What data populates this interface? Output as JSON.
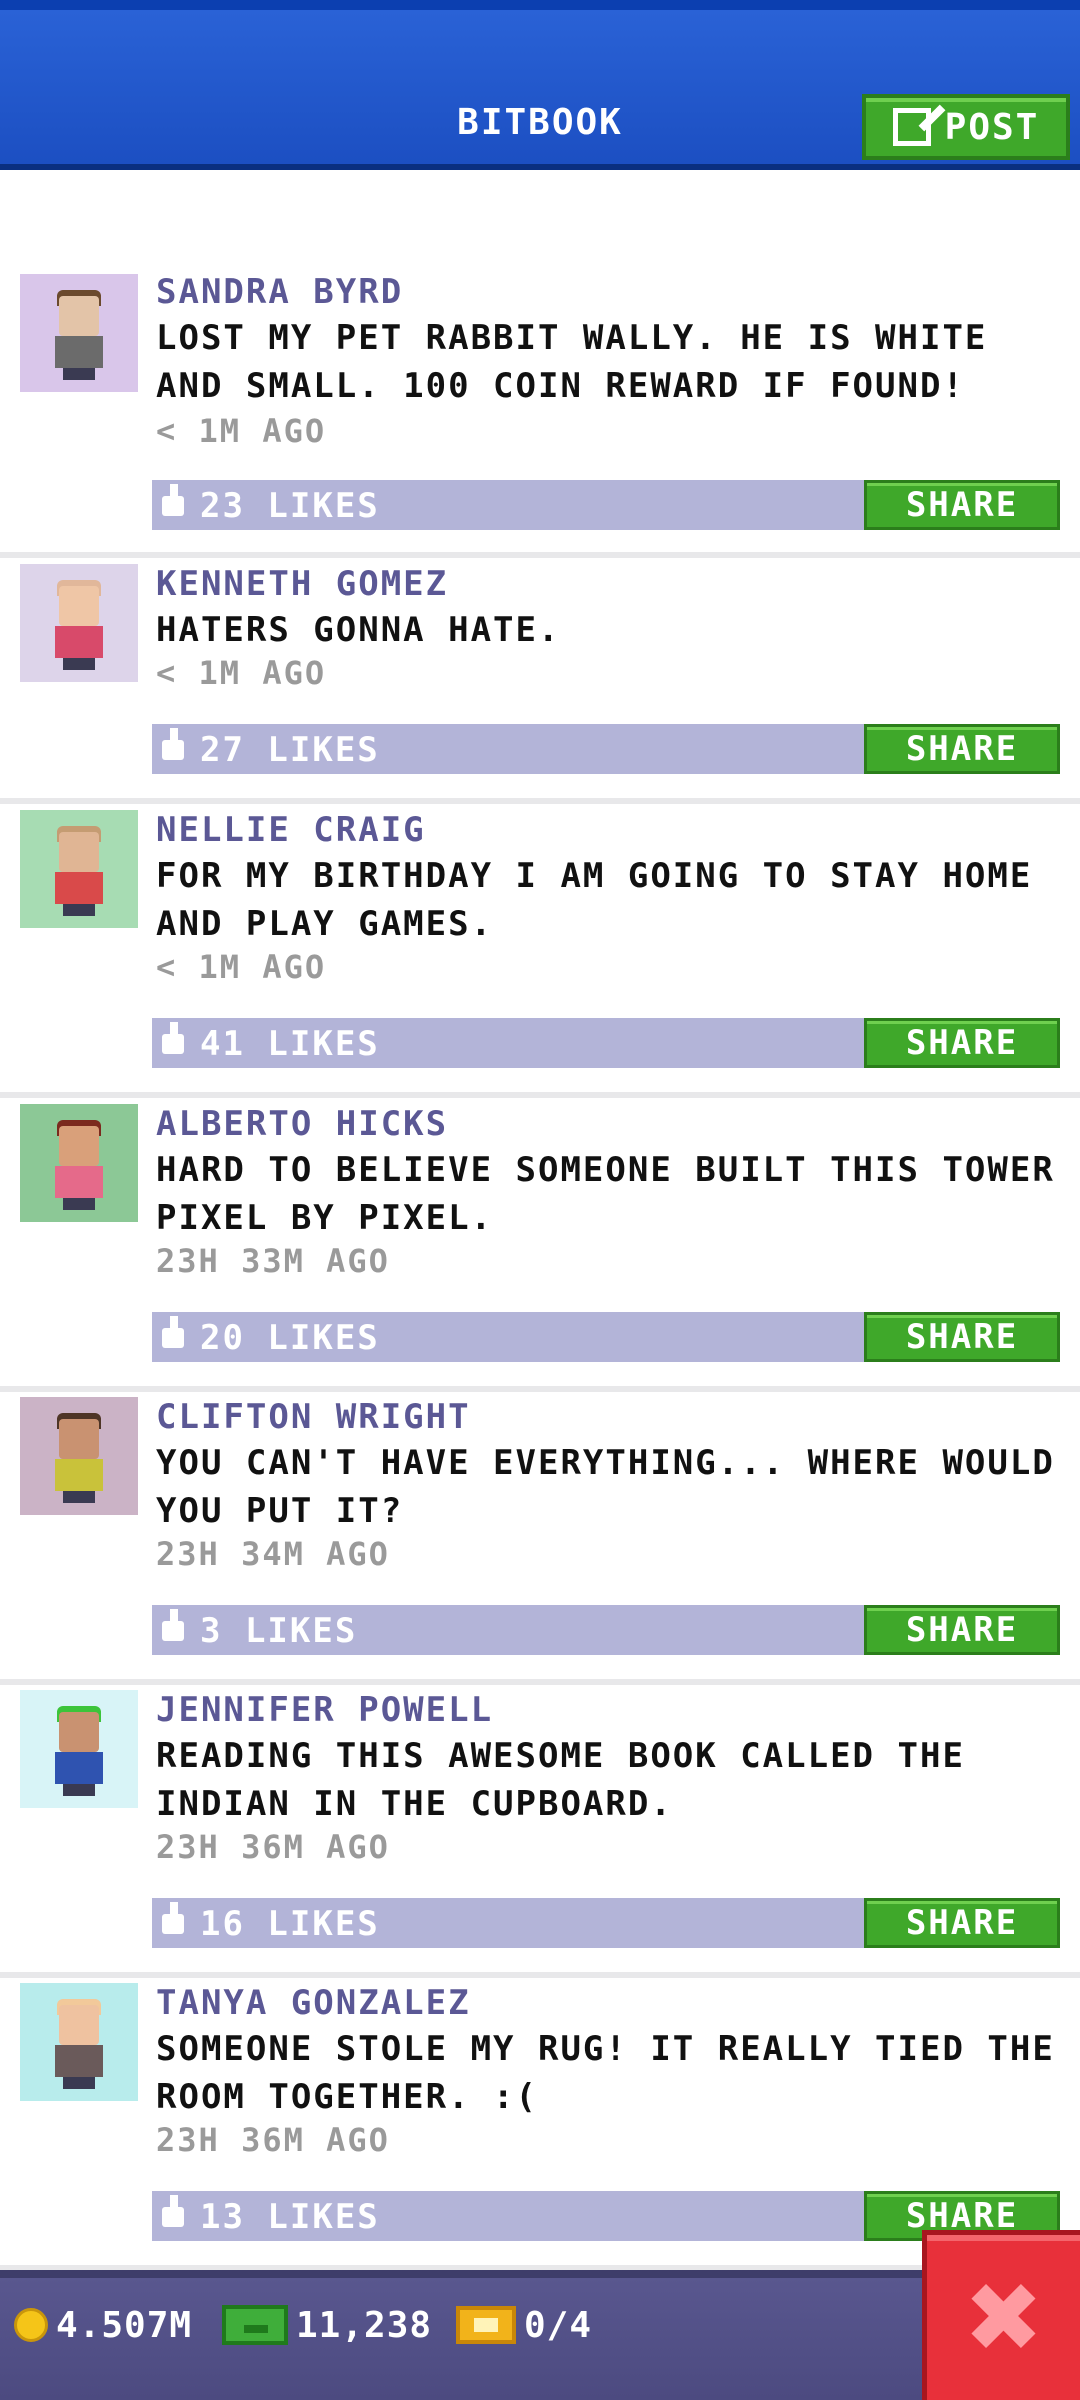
{
  "header": {
    "title": "BITBOOK",
    "post_label": "POST",
    "post_icon": "edit-icon"
  },
  "posts": [
    {
      "author": "SANDRA BYRD",
      "message": "LOST MY PET RABBIT WALLY. HE IS WHITE AND SMALL. 100 COIN REWARD IF FOUND!",
      "time": "< 1M AGO",
      "likes": "23 LIKES",
      "share": "SHARE",
      "avatar_bg": "#d9c6ea",
      "hair": "#6b4a2e",
      "skin": "#e3c4a8",
      "shirt": "#6b6b6b"
    },
    {
      "author": "KENNETH GOMEZ",
      "message": "HATERS GONNA HATE.",
      "time": "< 1M AGO",
      "likes": "27 LIKES",
      "share": "SHARE",
      "avatar_bg": "#ddd4ea",
      "hair": "#e1b79a",
      "skin": "#efc6a6",
      "shirt": "#d84a6a"
    },
    {
      "author": "NELLIE CRAIG",
      "message": "FOR MY BIRTHDAY I AM GOING TO STAY HOME AND PLAY GAMES.",
      "time": "< 1M AGO",
      "likes": "41 LIKES",
      "share": "SHARE",
      "avatar_bg": "#a7dcb3",
      "hair": "#c59c72",
      "skin": "#e0b594",
      "shirt": "#d94a4a"
    },
    {
      "author": "ALBERTO HICKS",
      "message": "HARD TO BELIEVE SOMEONE BUILT THIS TOWER PIXEL BY PIXEL.",
      "time": "23H 33M AGO",
      "likes": "20 LIKES",
      "share": "SHARE",
      "avatar_bg": "#8cc896",
      "hair": "#7b2a1e",
      "skin": "#d9a07a",
      "shirt": "#e56a8a"
    },
    {
      "author": "CLIFTON WRIGHT",
      "message": "YOU CAN'T HAVE EVERYTHING... WHERE WOULD YOU PUT IT?",
      "time": "23H 34M AGO",
      "likes": "3 LIKES",
      "share": "SHARE",
      "avatar_bg": "#cbb3c6",
      "hair": "#4e3526",
      "skin": "#c99271",
      "shirt": "#c9c23a"
    },
    {
      "author": "JENNIFER POWELL",
      "message": "READING THIS AWESOME BOOK CALLED THE INDIAN IN THE CUPBOARD.",
      "time": "23H 36M AGO",
      "likes": "16 LIKES",
      "share": "SHARE",
      "avatar_bg": "#d8f4f7",
      "hair": "#3cc43a",
      "skin": "#c99271",
      "shirt": "#2f53b0"
    },
    {
      "author": "TANYA GONZALEZ",
      "message": "SOMEONE STOLE MY RUG! IT REALLY TIED THE ROOM TOGETHER. :(",
      "time": "23H 36M AGO",
      "likes": "13 LIKES",
      "share": "SHARE",
      "avatar_bg": "#b8ecec",
      "hair": "#f2c99a",
      "skin": "#efc2a0",
      "shirt": "#6a5a5a"
    }
  ],
  "footer": {
    "coins": "4.507M",
    "bux": "11,238",
    "tickets": "0/4",
    "close_icon": "close-icon"
  }
}
